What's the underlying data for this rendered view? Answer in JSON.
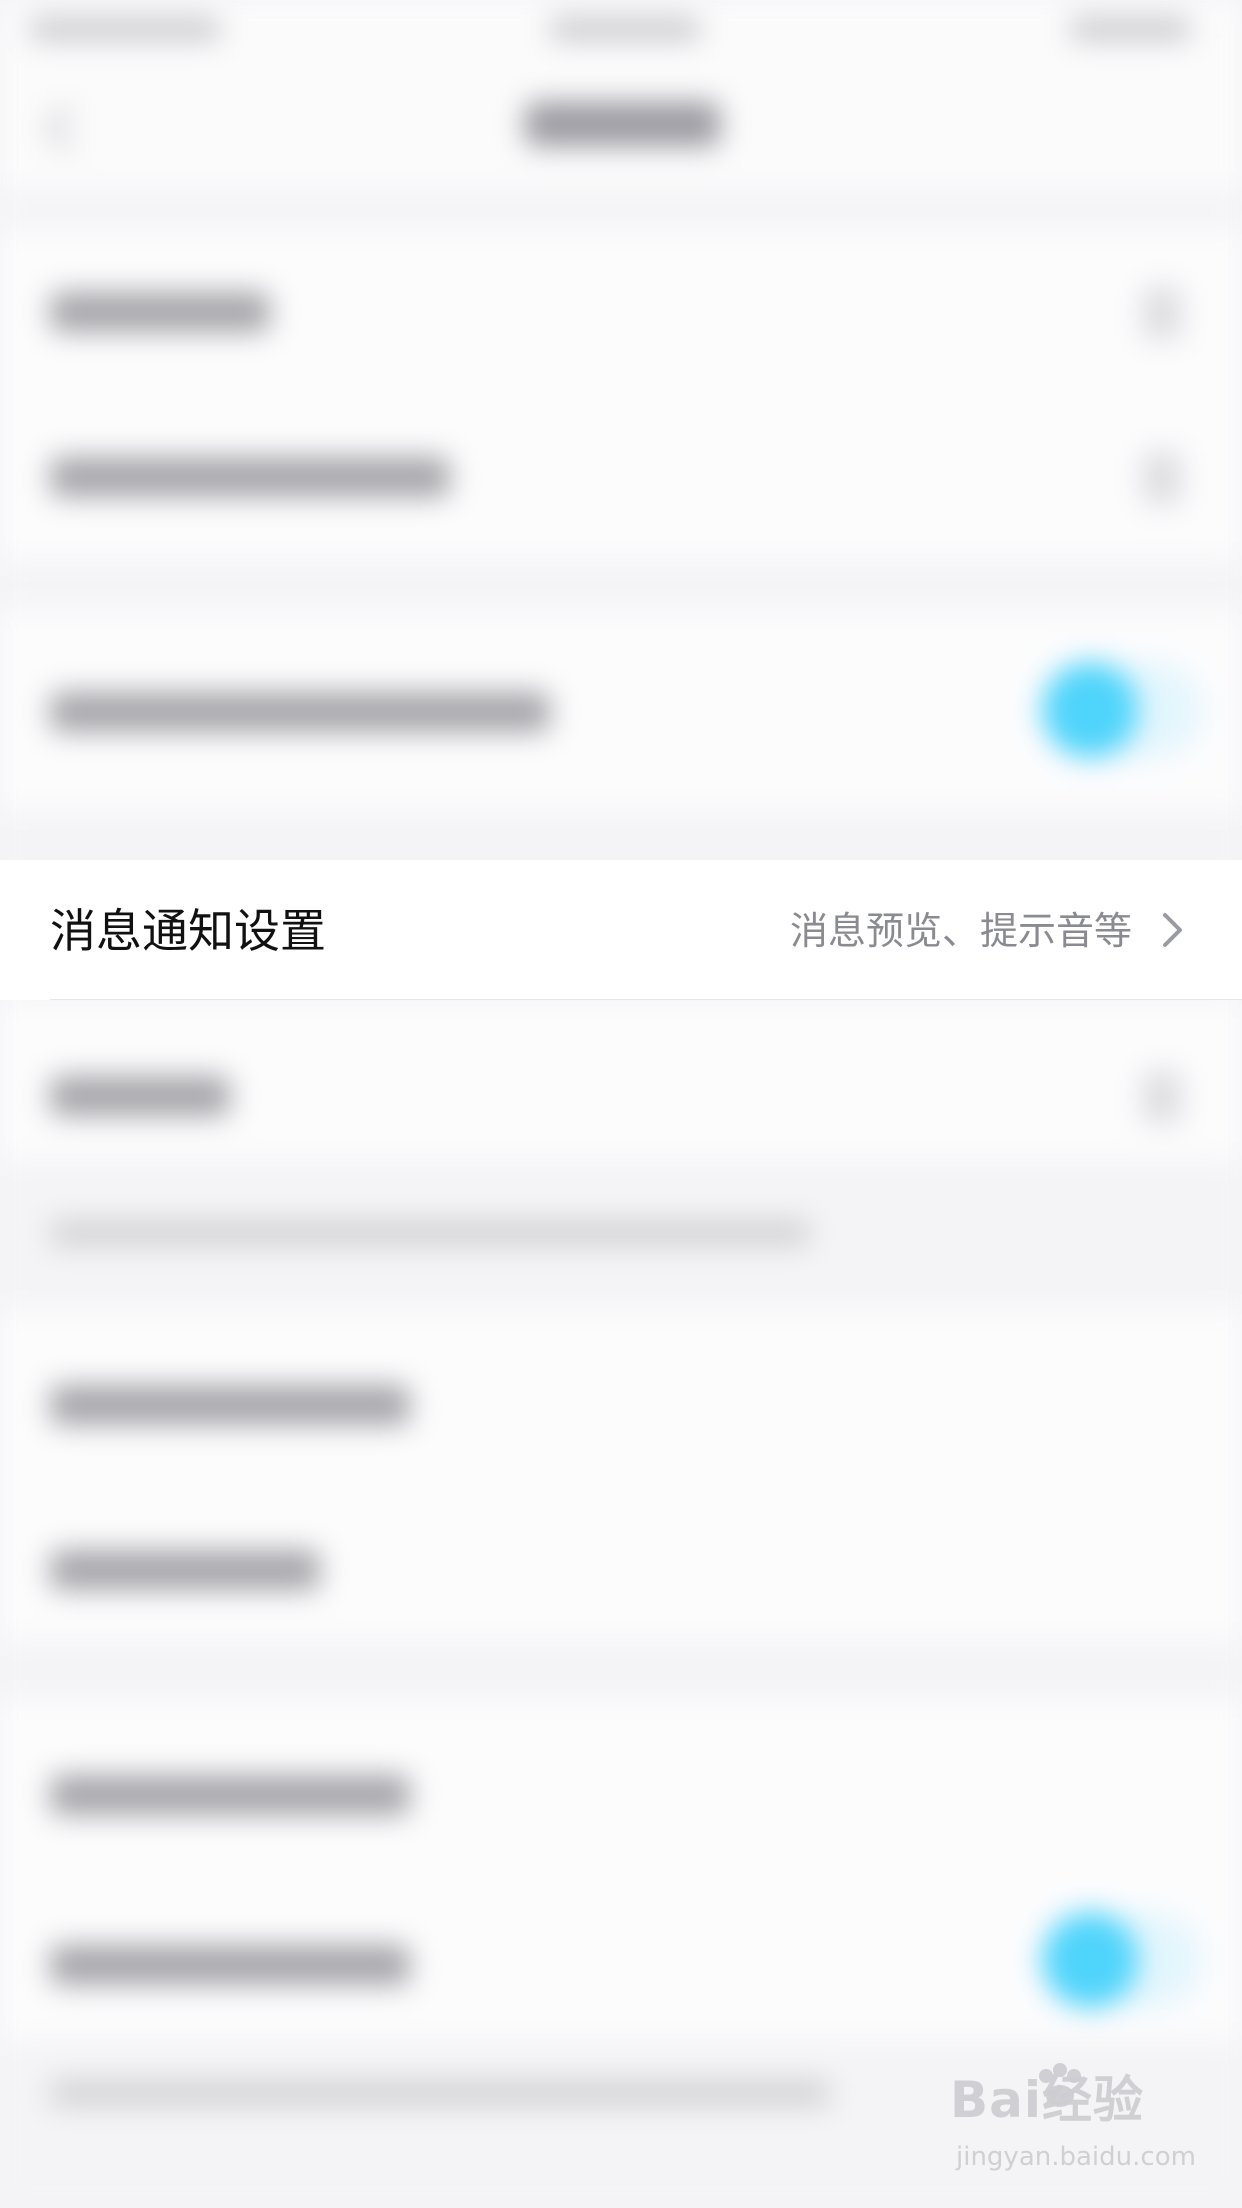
{
  "notification_settings_row": {
    "title": "消息通知设置",
    "value": "消息预览、提示音等",
    "chevron_icon": "chevron-right-icon"
  },
  "watermark": {
    "logo_text": "Bai经验",
    "url_text": "jingyan.baidu.com"
  },
  "colors": {
    "toggle_on": "#4fd4fb",
    "primary_text": "#111111",
    "secondary_text": "#8a8a92",
    "background": "#f4f4f6"
  }
}
